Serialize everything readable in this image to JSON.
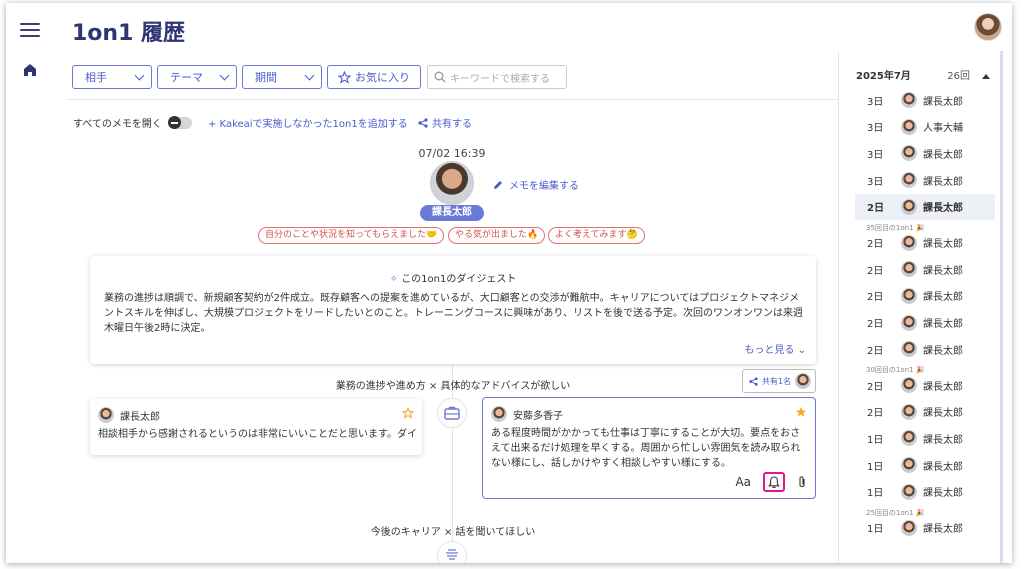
{
  "app": {
    "title": "1on1 履歴"
  },
  "filters": {
    "partner": "相手",
    "theme": "テーマ",
    "period": "期間",
    "favorites": "お気に入り",
    "search_placeholder": "キーワードで検索する"
  },
  "toolbar": {
    "open_all_memos": "すべてのメモを開く",
    "add_outside": "+ Kakeaiで実施しなかった1on1を追加する",
    "share": "共有する"
  },
  "session": {
    "datetime": "07/02 16:39",
    "person": "課長太郎",
    "edit_memo": "メモを編集する",
    "tags": [
      "自分のことや状況を知ってもらえました🤝",
      "やる気が出ました🔥",
      "よく考えてみます🤔"
    ]
  },
  "digest": {
    "title": "この1on1のダイジェスト",
    "body": "業務の進捗は順調で、新規顧客契約が2件成立。既存顧客への提案を進めているが、大口顧客との交渉が難航中。キャリアについてはプロジェクトマネジメントスキルを伸ばし、大規模プロジェクトをリードしたいとのこと。トレーニングコースに興味があり、リストを後で送る予定。次回のワンオンワンは来週木曜日午後2時に決定。",
    "more": "もっと見る"
  },
  "topics": [
    {
      "title": "業務の進捗や進め方 × 具体的なアドバイスが欲しい",
      "shared": "共有1名",
      "left_note": {
        "author": "課長太郎",
        "text": "相談相手から感謝されるというのは非常にいいことだと思います。ダイ"
      },
      "right_note": {
        "author": "安藤多香子",
        "text": "ある程度時間がかかっても仕事は丁寧にすることが大切。要点をおさえて出来るだけ処理を早くする。周囲から忙しい雰囲気を読み取られない様にし、話しかけやすく相談しやすい様にする。",
        "font_label": "Aa"
      }
    },
    {
      "title": "今後のキャリア × 話を聞いてほしい"
    }
  ],
  "history": {
    "month": "2025年7月",
    "count": "26回",
    "rows": [
      {
        "day": "3日",
        "name": "課長太郎"
      },
      {
        "day": "3日",
        "name": "人事大輔"
      },
      {
        "day": "3日",
        "name": "課長太郎"
      },
      {
        "day": "3日",
        "name": "課長太郎"
      },
      {
        "day": "2日",
        "name": "課長太郎"
      },
      {
        "sep": "35回目の1on1 🎉"
      },
      {
        "day": "2日",
        "name": "課長太郎"
      },
      {
        "day": "2日",
        "name": "課長太郎"
      },
      {
        "day": "2日",
        "name": "課長太郎"
      },
      {
        "day": "2日",
        "name": "課長太郎"
      },
      {
        "day": "2日",
        "name": "課長太郎"
      },
      {
        "sep": "30回目の1on1 🎉"
      },
      {
        "day": "2日",
        "name": "課長太郎"
      },
      {
        "day": "2日",
        "name": "課長太郎"
      },
      {
        "day": "1日",
        "name": "課長太郎"
      },
      {
        "day": "1日",
        "name": "課長太郎"
      },
      {
        "day": "1日",
        "name": "課長太郎"
      },
      {
        "sep": "25回目の1on1 🎉"
      },
      {
        "day": "1日",
        "name": "課長太郎"
      }
    ]
  },
  "colors": {
    "accent": "#4b5acb",
    "title": "#2e3572",
    "tag": "#d4514d",
    "highlight": "#e0179c",
    "star": "#f5a623"
  }
}
